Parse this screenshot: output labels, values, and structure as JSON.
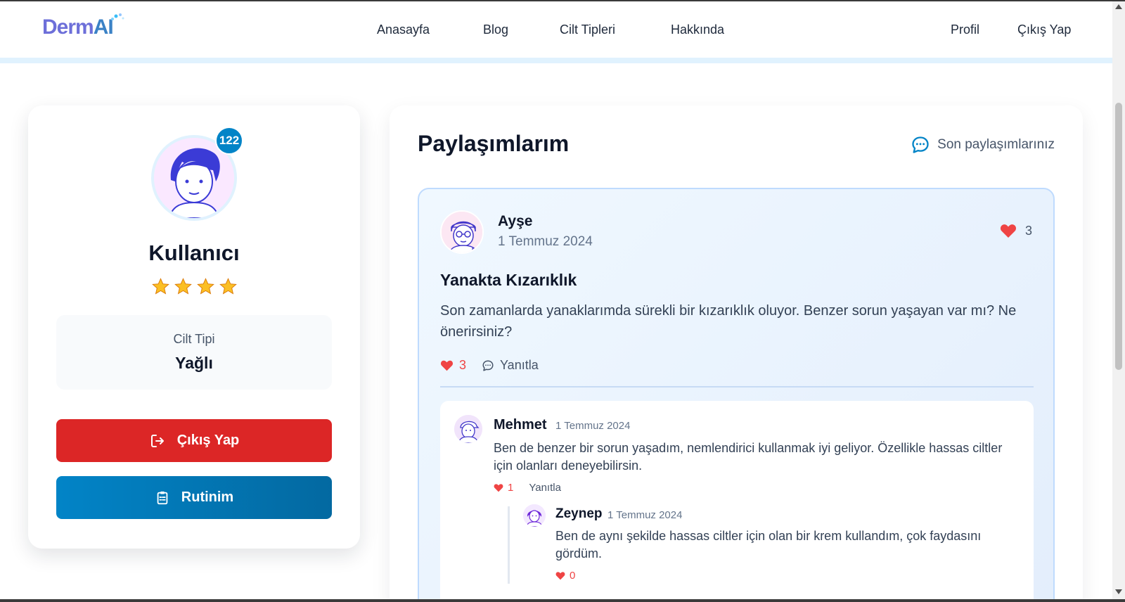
{
  "brand": {
    "logo_part1": "Derm",
    "logo_part2": "AI"
  },
  "nav": {
    "links": [
      "Anasayfa",
      "Blog",
      "Cilt Tipleri",
      "Hakkında"
    ],
    "right": [
      "Profil",
      "Çıkış Yap"
    ]
  },
  "profile": {
    "badge": "122",
    "name": "Kullanıcı",
    "stars": 4,
    "skin_type_label": "Cilt Tipi",
    "skin_type_value": "Yağlı",
    "logout_label": "Çıkış Yap",
    "routine_label": "Rutinim"
  },
  "posts": {
    "title": "Paylaşımlarım",
    "recent_label": "Son paylaşımlarınız",
    "items": [
      {
        "author": "Ayşe",
        "date": "1 Temmuz 2024",
        "likes_top": "3",
        "title": "Yanakta Kızarıklık",
        "body": "Son zamanlarda yanaklarımda sürekli bir kızarıklık oluyor. Benzer sorun yaşayan var mı? Ne önerirsiniz?",
        "likes": "3",
        "reply_label": "Yanıtla",
        "comments": [
          {
            "author": "Mehmet",
            "date": "1 Temmuz 2024",
            "body": "Ben de benzer bir sorun yaşadım, nemlendirici kullanmak iyi geliyor. Özellikle hassas ciltler için olanları deneyebilirsin.",
            "likes": "1",
            "reply_label": "Yanıtla",
            "replies": [
              {
                "author": "Zeynep",
                "date": "1 Temmuz 2024",
                "body": "Ben de aynı şekilde hassas ciltler için olan bir krem kullandım, çok faydasını gördüm.",
                "likes": "0"
              }
            ]
          }
        ]
      }
    ]
  },
  "colors": {
    "accent": "#0284c7",
    "danger": "#dc2626",
    "like": "#ef4444",
    "text": "#0f172a"
  },
  "icons": [
    "logout-icon",
    "clipboard-icon",
    "chat-icon",
    "heart-icon",
    "star-icon"
  ]
}
